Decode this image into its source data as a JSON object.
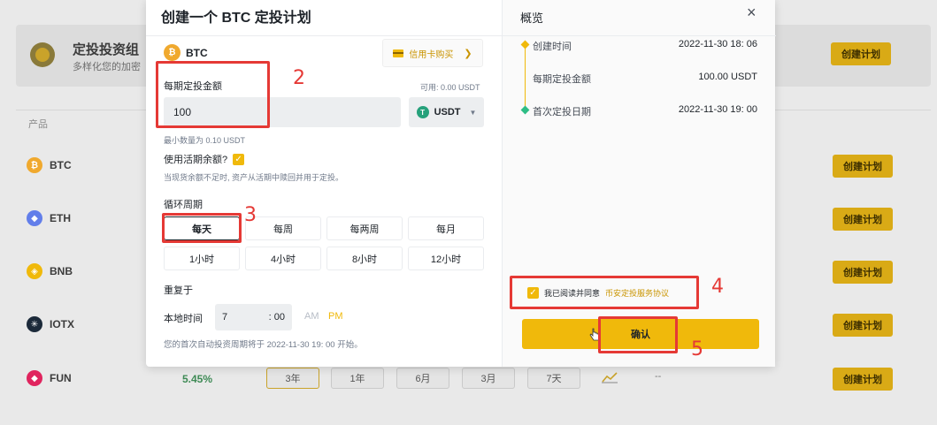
{
  "background": {
    "title": "定投投资组",
    "subtitle": "多样化您的加密",
    "top_create_label": "创建计划",
    "column_header": "产品",
    "rows": [
      {
        "coin": "BTC",
        "color": "#f0a92e",
        "glyph": "₿",
        "create_label": "创建计划"
      },
      {
        "coin": "ETH",
        "color": "#627eea",
        "glyph": "◆",
        "create_label": "创建计划"
      },
      {
        "coin": "BNB",
        "color": "#f0b90b",
        "glyph": "◈",
        "create_label": "创建计划"
      },
      {
        "coin": "IOTX",
        "color": "#1c2a3a",
        "glyph": "✳",
        "create_label": "创建计划"
      },
      {
        "coin": "FUN",
        "color": "#e0245e",
        "glyph": "◆",
        "create_label": "创建计划"
      }
    ],
    "fun_apy": "5.45%",
    "fun_periods": [
      "3年",
      "1年",
      "6月",
      "3月",
      "7天"
    ],
    "fun_trend_placeholder": "--",
    "fun_create_label": "创建计划"
  },
  "modal": {
    "title": "创建一个 BTC 定投计划",
    "coin": "BTC",
    "buy_with_card_label": "信用卡购买",
    "amount_label": "每期定投金额",
    "available_text": "可用: 0.00 USDT",
    "amount_value": "100",
    "currency": "USDT",
    "min_amount_text": "最小数量为 0.10 USDT",
    "use_flexible_label": "使用活期余额?",
    "use_flexible_checked": true,
    "use_flexible_hint": "当现货余额不足时, 资产从活期中赎回并用于定投。",
    "cycle_label": "循环周期",
    "cycle_options": [
      "每天",
      "每周",
      "每两周",
      "每月",
      "1小时",
      "4小时",
      "8小时",
      "12小时"
    ],
    "cycle_selected": "每天",
    "repeat_label": "重复于",
    "local_time_label": "本地时间",
    "time_hour": "7",
    "time_minute": ": 00",
    "am_label": "AM",
    "pm_label": "PM",
    "meridiem_selected": "PM",
    "first_invest_text": "您的首次自动投资周期将于 2022-11-30 19: 00 开始。"
  },
  "overview": {
    "title": "概览",
    "close_icon": "×",
    "items": [
      {
        "label": "创建时间",
        "value": "2022-11-30 18: 06"
      },
      {
        "label": "每期定投金额",
        "value": "100.00 USDT"
      },
      {
        "label": "首次定投日期",
        "value": "2022-11-30 19: 00"
      }
    ],
    "agree_prefix": "我已阅读并同意",
    "agree_link": "币安定投服务协议",
    "agree_checked": true,
    "confirm_label": "确认"
  },
  "annotations": [
    "2",
    "3",
    "4",
    "5"
  ],
  "colors": {
    "accent": "#f0b90b",
    "annotation": "#e53935",
    "link": "#c99400"
  }
}
